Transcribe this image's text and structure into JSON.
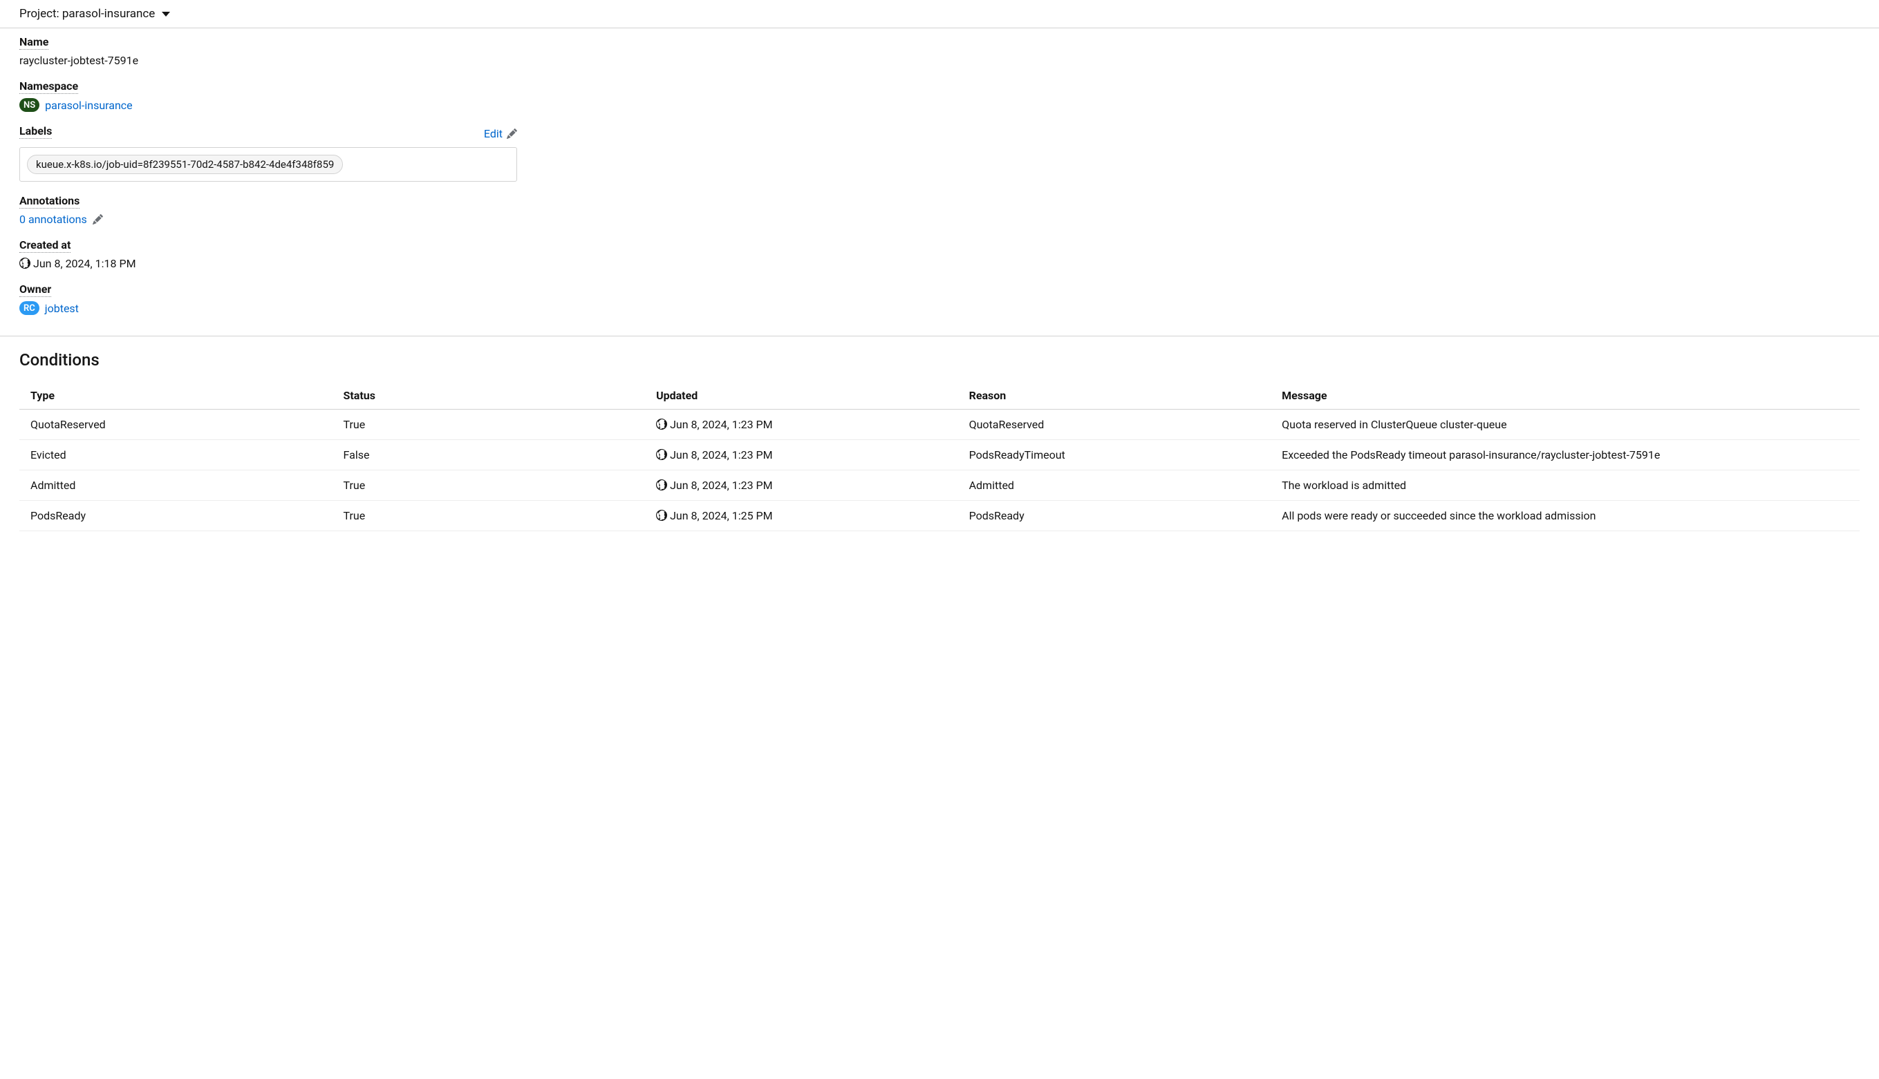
{
  "project_bar": {
    "label": "Project: parasol-insurance"
  },
  "details": {
    "name_label": "Name",
    "name_value": "raycluster-jobtest-7591e",
    "namespace_label": "Namespace",
    "namespace_badge": "NS",
    "namespace_value": "parasol-insurance",
    "labels_label": "Labels",
    "labels_edit": "Edit",
    "labels_chip": "kueue.x-k8s.io/job-uid=8f239551-70d2-4587-b842-4de4f348f859",
    "annotations_label": "Annotations",
    "annotations_value": "0 annotations",
    "created_label": "Created at",
    "created_value": "Jun 8, 2024, 1:18 PM",
    "owner_label": "Owner",
    "owner_badge": "RC",
    "owner_value": "jobtest"
  },
  "conditions": {
    "heading": "Conditions",
    "columns": {
      "type": "Type",
      "status": "Status",
      "updated": "Updated",
      "reason": "Reason",
      "message": "Message"
    },
    "rows": [
      {
        "type": "QuotaReserved",
        "status": "True",
        "updated": "Jun 8, 2024, 1:23 PM",
        "reason": "QuotaReserved",
        "message": "Quota reserved in ClusterQueue cluster-queue"
      },
      {
        "type": "Evicted",
        "status": "False",
        "updated": "Jun 8, 2024, 1:23 PM",
        "reason": "PodsReadyTimeout",
        "message": "Exceeded the PodsReady timeout parasol-insurance/raycluster-jobtest-7591e"
      },
      {
        "type": "Admitted",
        "status": "True",
        "updated": "Jun 8, 2024, 1:23 PM",
        "reason": "Admitted",
        "message": "The workload is admitted"
      },
      {
        "type": "PodsReady",
        "status": "True",
        "updated": "Jun 8, 2024, 1:25 PM",
        "reason": "PodsReady",
        "message": "All pods were ready or succeeded since the workload admission"
      }
    ]
  }
}
